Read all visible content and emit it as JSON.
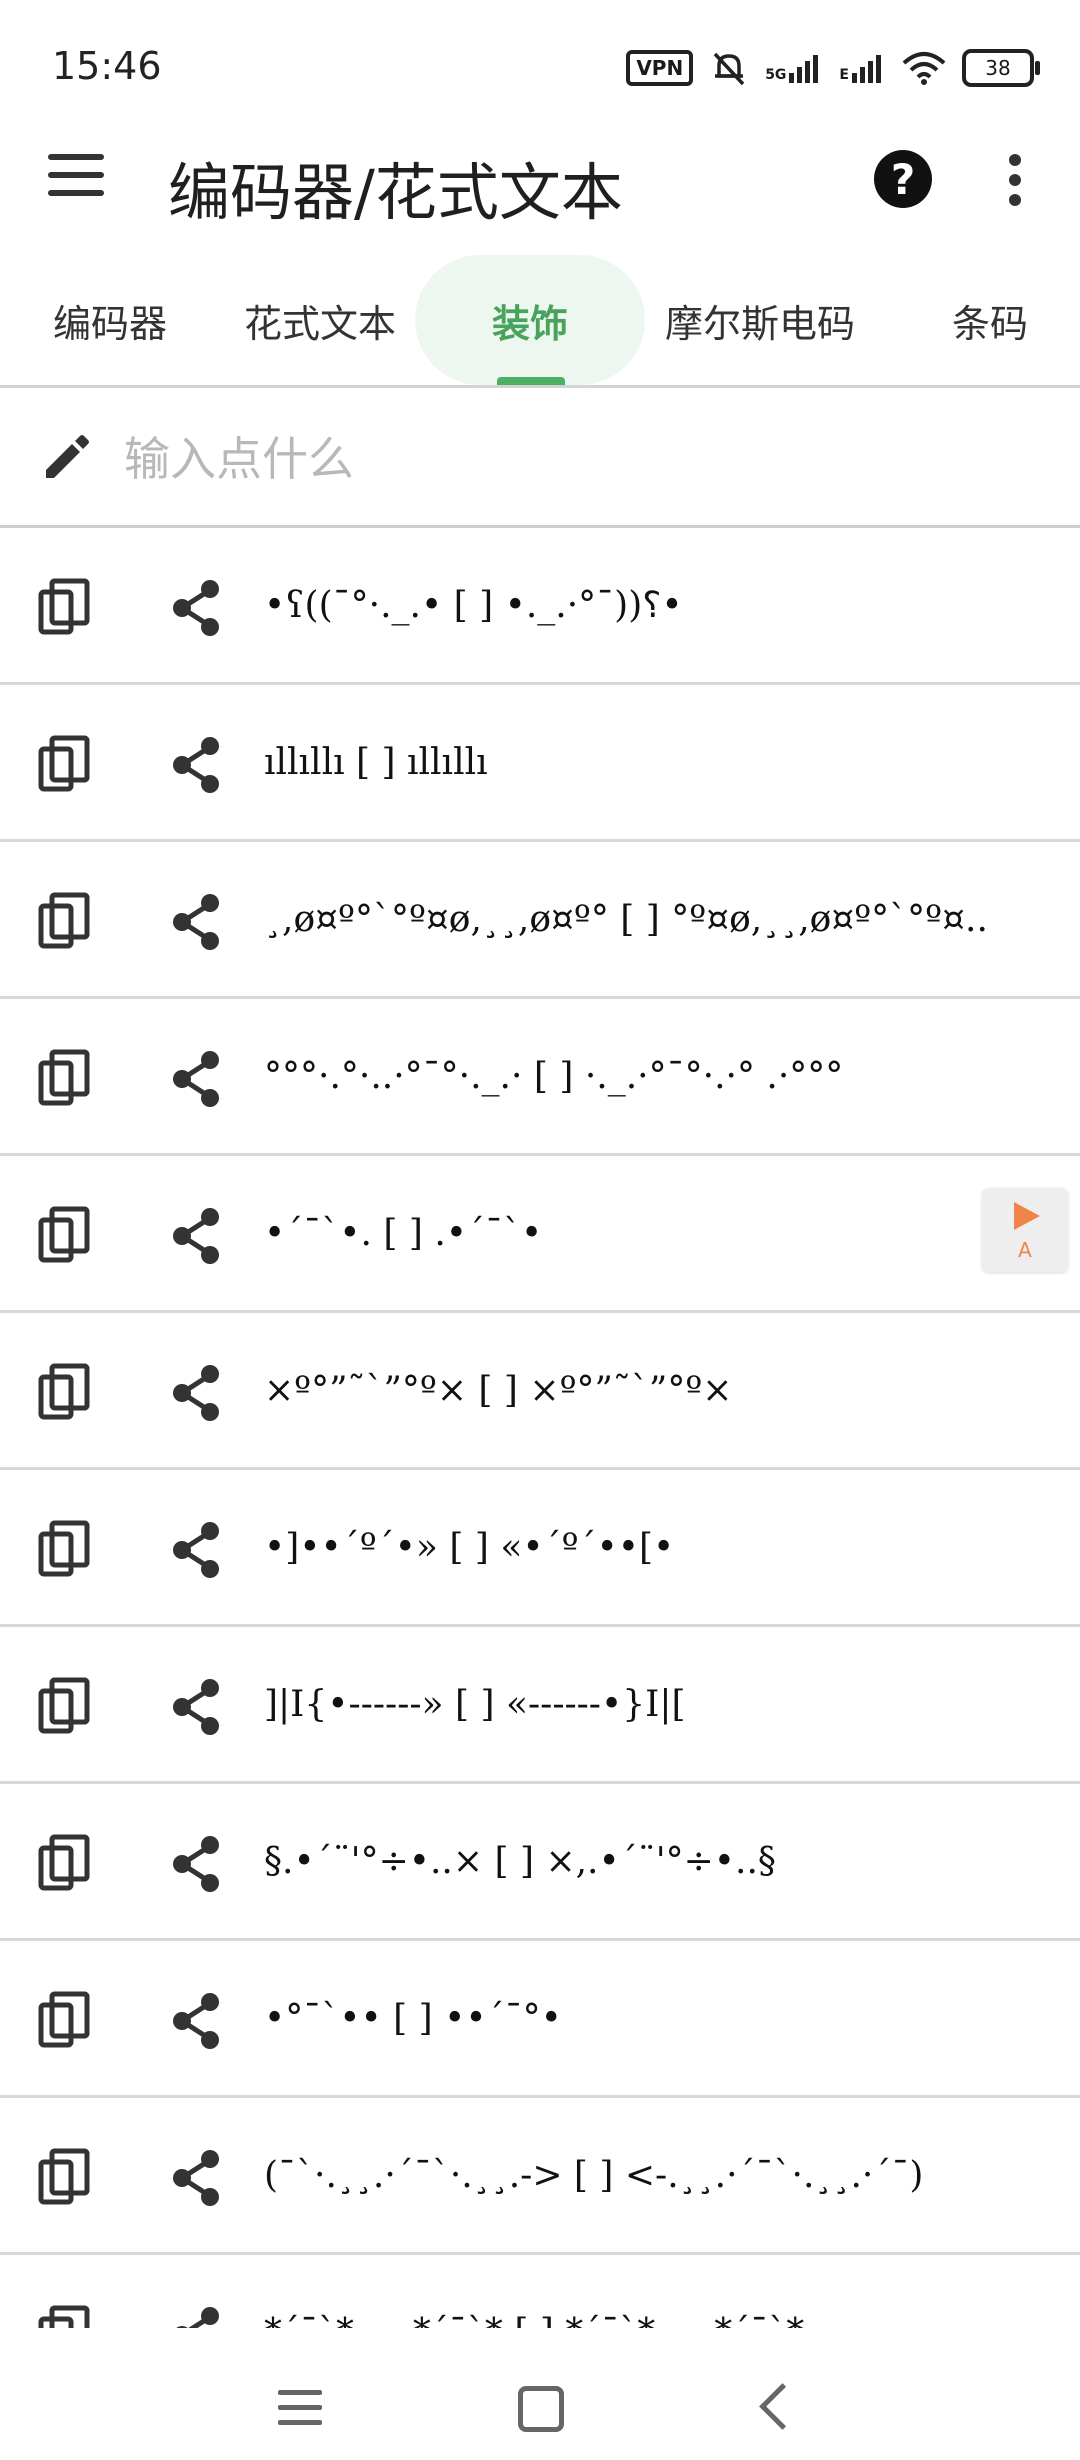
{
  "status_bar": {
    "time": "15:46",
    "vpn": "VPN",
    "network_5g": "5G",
    "network_e": "E",
    "battery": "38"
  },
  "app_bar": {
    "title": "编码器/花式文本"
  },
  "tabs": [
    {
      "label": "编码器"
    },
    {
      "label": "花式文本"
    },
    {
      "label": "装饰"
    },
    {
      "label": "摩尔斯电码"
    },
    {
      "label": "条码"
    }
  ],
  "active_tab": "装饰",
  "input": {
    "value": "",
    "placeholder": "输入点什么"
  },
  "decorations": [
    "•ʕ((¯°·._.• [  ] •._.·°¯))؟•",
    "ıllıllı [  ] ıllıllı",
    "¸,ø¤º°`°º¤ø,¸¸,ø¤º° [  ] °º¤ø,¸¸,ø¤º°`°º¤..",
    "°°°·.°·..·°¯°·._.· [  ] ·._.·°¯°·.·° .·°°°",
    "•´¯`•. [  ] .•´¯`•",
    "×º°”˜`”°º× [  ] ×º°”˜`”°º×",
    "•]••´º´•» [  ] «•´º´••[•",
    "]|I{•------» [  ] «------•}I|[",
    "§.•´¨'°÷•..× [  ] ×,.•´¨'°÷•..§",
    "•°¯`•• [  ] ••´¯°•",
    "(¯`·.¸¸.·´¯`·.¸¸.-> [  ] <-.¸¸.·´¯`·.¸¸.·´¯)",
    "*´¯`*.¸¸.*´¯`* [  ] *´¯`*.¸¸.*´¯`*"
  ],
  "floating_button": {
    "label": "A"
  }
}
